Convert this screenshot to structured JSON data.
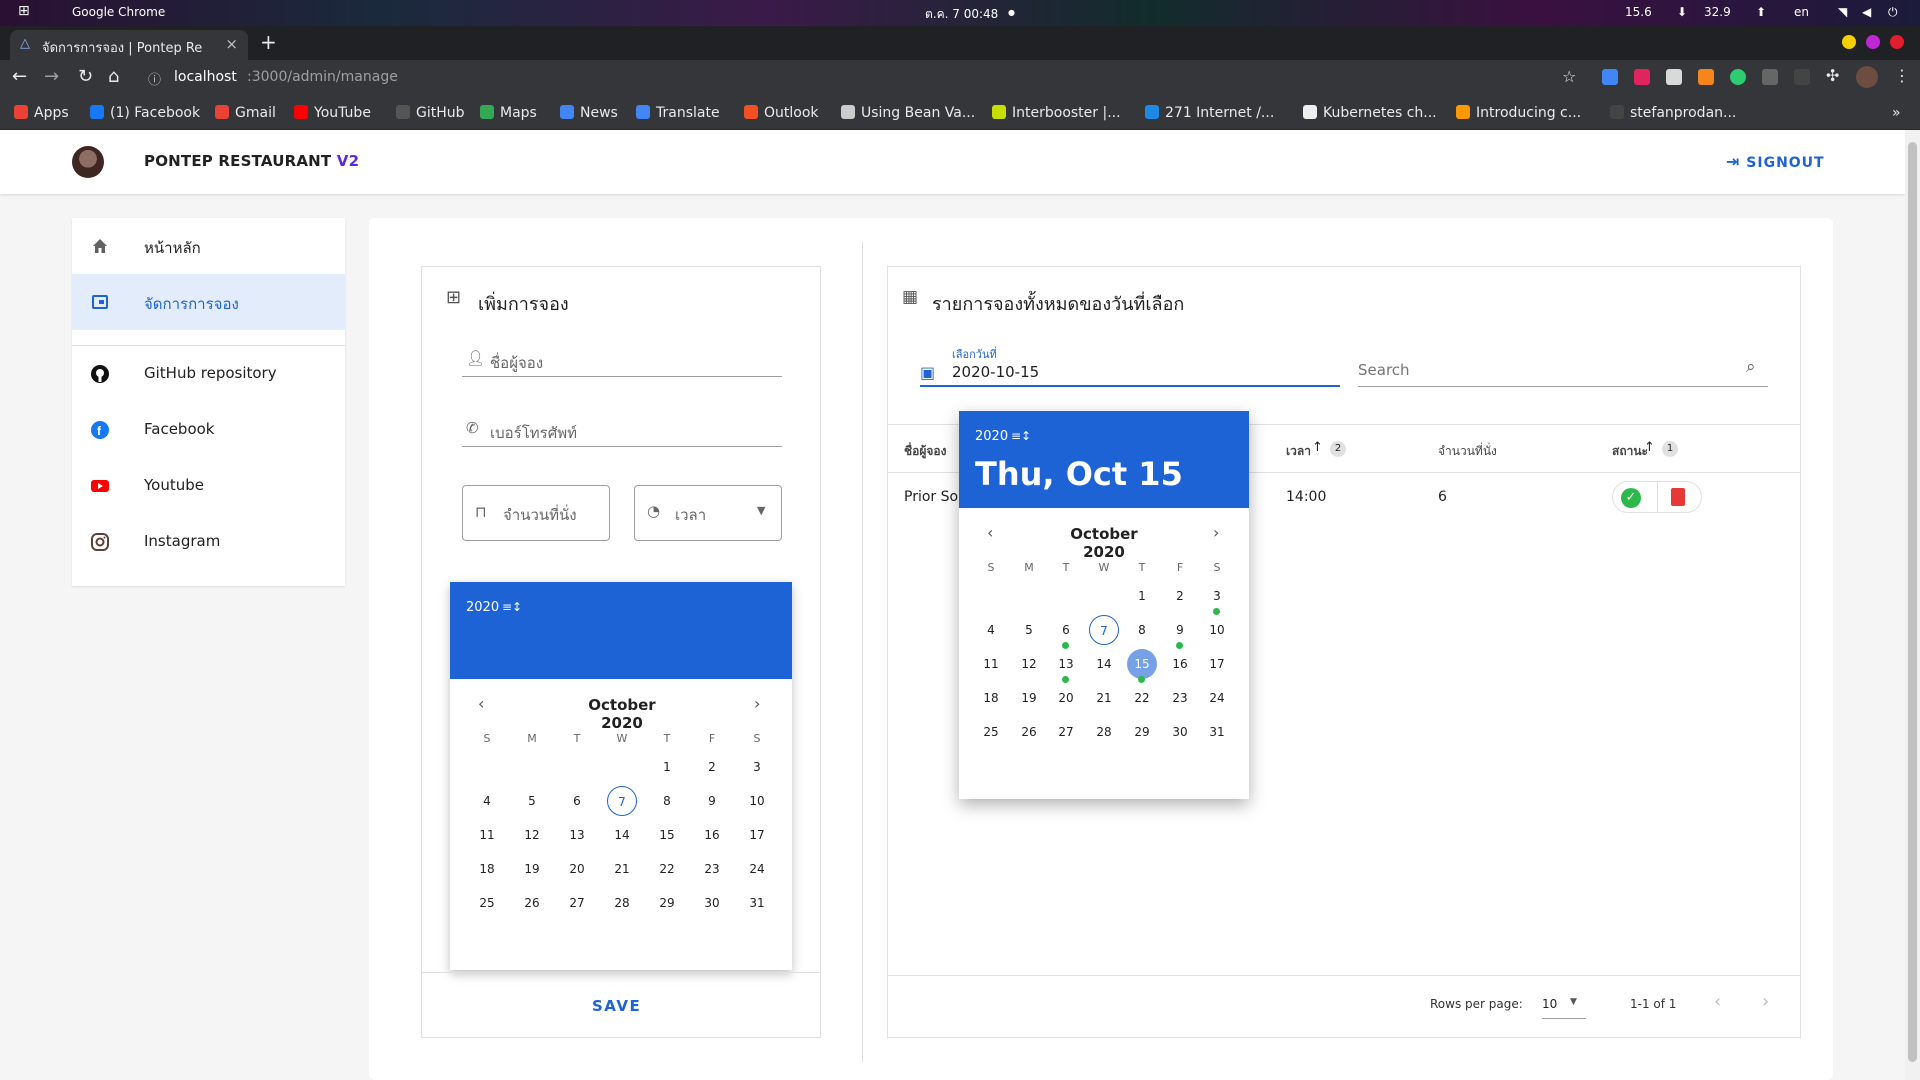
{
  "os_bar": {
    "app": "Google Chrome",
    "clock": "ต.ค. 7  00:48",
    "net_down": "15.6",
    "net_up": "32.9",
    "lang": "en"
  },
  "browser": {
    "tab_title": "จัดการการจอง | Pontep Re",
    "url_host": "localhost",
    "url_path": ":3000/admin/manage",
    "bookmarks": [
      {
        "label": "Apps",
        "color": "#ea4335"
      },
      {
        "label": "(1) Facebook",
        "color": "#1877f2"
      },
      {
        "label": "Gmail",
        "color": "#ea4335"
      },
      {
        "label": "YouTube",
        "color": "#ff0000"
      },
      {
        "label": "GitHub",
        "color": "#555555"
      },
      {
        "label": "Maps",
        "color": "#34a853"
      },
      {
        "label": "News",
        "color": "#4285f4"
      },
      {
        "label": "Translate",
        "color": "#4285f4"
      },
      {
        "label": "Outlook",
        "color": "#f25022"
      },
      {
        "label": "Using Bean Va...",
        "color": "#cccccc"
      },
      {
        "label": "Interbooster |...",
        "color": "#c8e000"
      },
      {
        "label": "271 Internet /...",
        "color": "#1e88e5"
      },
      {
        "label": "Kubernetes ch...",
        "color": "#eeeeee"
      },
      {
        "label": "Introducing c...",
        "color": "#ff9800"
      },
      {
        "label": "stefanprodan...",
        "color": "#444444"
      }
    ]
  },
  "header": {
    "brand": "PONTEP RESTAURANT",
    "version": "V2",
    "signout": "SIGNOUT"
  },
  "sidebar": {
    "items": [
      {
        "label": "หน้าหลัก",
        "icon": "home-icon"
      },
      {
        "label": "จัดการการจอง",
        "icon": "booking-icon",
        "active": true
      },
      {
        "label": "GitHub repository",
        "icon": "github-icon"
      },
      {
        "label": "Facebook",
        "icon": "facebook-icon"
      },
      {
        "label": "Youtube",
        "icon": "youtube-icon"
      },
      {
        "label": "Instagram",
        "icon": "instagram-icon"
      }
    ]
  },
  "add_form": {
    "title": "เพิ่มการจอง",
    "name_placeholder": "ชื่อผู้จอง",
    "phone_placeholder": "เบอร์โทรศัพท์",
    "seats_label": "จำนวนที่นั่ง",
    "time_label": "เวลา",
    "save": "SAVE",
    "calendar": {
      "year": "2020",
      "year_suffix": "≡↕",
      "month": "October 2020",
      "dow": [
        "S",
        "M",
        "T",
        "W",
        "T",
        "F",
        "S"
      ],
      "days": [
        "1",
        "2",
        "3",
        "4",
        "5",
        "6",
        "7",
        "8",
        "9",
        "10",
        "11",
        "12",
        "13",
        "14",
        "15",
        "16",
        "17",
        "18",
        "19",
        "20",
        "21",
        "22",
        "23",
        "24",
        "25",
        "26",
        "27",
        "28",
        "29",
        "30",
        "31"
      ],
      "today": "7"
    }
  },
  "list": {
    "title": "รายการจองทั้งหมดของวันที่เลือก",
    "date_label": "เลือกวันที่",
    "date_value": "2020-10-15",
    "search_placeholder": "Search",
    "columns": {
      "name": "ชื่อผู้จอง",
      "time": "เวลา",
      "time_sort": "2",
      "seats": "จำนวนที่นั่ง",
      "status": "สถานะ",
      "status_sort": "1"
    },
    "rows": [
      {
        "name": "Prior Solu",
        "time": "14:00",
        "seats": "6"
      }
    ],
    "footer": {
      "rows_per_page_label": "Rows per page:",
      "rows_per_page": "10",
      "range": "1-1 of 1"
    },
    "popup_calendar": {
      "year": "2020",
      "year_suffix": "≡↕",
      "date_title": "Thu, Oct 15",
      "month": "October 2020",
      "dow": [
        "S",
        "M",
        "T",
        "W",
        "T",
        "F",
        "S"
      ],
      "days": [
        "1",
        "2",
        "3",
        "4",
        "5",
        "6",
        "7",
        "8",
        "9",
        "10",
        "11",
        "12",
        "13",
        "14",
        "15",
        "16",
        "17",
        "18",
        "19",
        "20",
        "21",
        "22",
        "23",
        "24",
        "25",
        "26",
        "27",
        "28",
        "29",
        "30",
        "31"
      ],
      "today": "7",
      "selected": "15",
      "event_days": [
        "3",
        "6",
        "9",
        "13",
        "15"
      ]
    }
  },
  "colors": {
    "primary": "#1e63d6",
    "accent": "#5c29e0",
    "event": "#2db84b",
    "danger": "#e53935"
  }
}
